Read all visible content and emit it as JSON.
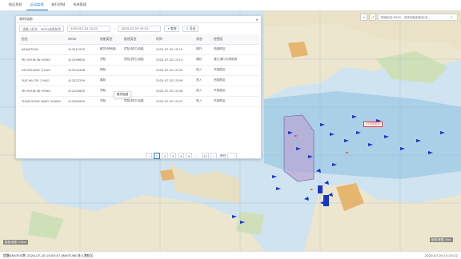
{
  "nav": {
    "tabs": [
      {
        "label": "航区揽检"
      },
      {
        "label": "运动监视"
      },
      {
        "label": "航行控制"
      },
      {
        "label": "系统管理"
      }
    ]
  },
  "map": {
    "search_placeholder": "搜索船名/MMSI，或查询船舶航迹/名...",
    "red_label": "VTS信息站",
    "scale_left": "航程(海里) 10km",
    "scale_right": "航程(海里) 5km"
  },
  "panel": {
    "title": "实时动态",
    "keyword_placeholder": "请输入船名、MMSI或船舶类型",
    "date_from": "2020-07-20 12:21",
    "date_to": "2020-07-20 15:21",
    "search_label": "查询",
    "export_label": "导出",
    "columns": [
      "船名",
      "MMSI",
      "船舶类型",
      "航迹类型",
      "时间",
      "状态",
      "经营区"
    ],
    "rows": [
      [
        "JIANXITU06",
        "413241970",
        "散货/其他船",
        "危险/其它/油船",
        "2020-07-20 15:15",
        "离开",
        "西部航区"
      ],
      [
        "MV SHUN JIN HONG",
        "412498650",
        "货轮",
        "危险/其它/油船",
        "2020-07-20 15:14",
        "通过",
        "湛江港口大桥航段"
      ],
      [
        "XM ZHUANG Z HAO",
        "413234436",
        "拖轮",
        "",
        "2020-07-20 15:09",
        "进入",
        "东线航区"
      ],
      [
        "YUE HAI TIE 1 HAO",
        "412522259",
        "客轮",
        "",
        "2020-07-20 15:09",
        "进入",
        "西部航区"
      ],
      [
        "MV SHUN JIN HONG",
        "412409650",
        "货轮",
        "",
        "2020-07-20 15:08",
        "进入",
        "东线航区"
      ],
      [
        "YUAN DONG YANG GUANG",
        "413464650",
        "货轮",
        "危险/其它/油船",
        "2020-07-20 15:07",
        "进入",
        "东线航区"
      ]
    ],
    "tooltip": "散货船舶",
    "pager": {
      "prev": "‹",
      "pages": [
        "1",
        "2",
        "3",
        "4",
        "5",
        "...",
        "22"
      ],
      "next": "›",
      "goto_label": "前往"
    }
  },
  "status": {
    "message": "提醒(JN4355港) 2020-07-20 15:05:47,JINXITU06 进入港航区",
    "time": "2020-07-20 15:20:22"
  }
}
